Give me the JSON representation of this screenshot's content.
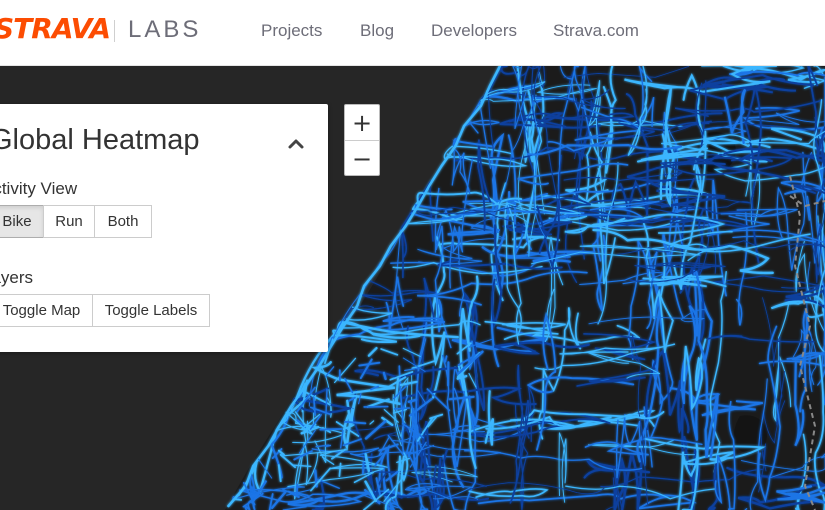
{
  "header": {
    "logo_brand": "STRAVA",
    "logo_sub": "LABS",
    "nav": [
      {
        "label": "Projects"
      },
      {
        "label": "Blog"
      },
      {
        "label": "Developers"
      },
      {
        "label": "Strava.com"
      }
    ]
  },
  "panel": {
    "title": "Global Heatmap",
    "collapse_icon": "chevron-up-icon",
    "activity_view": {
      "label": "Activity View",
      "options": [
        {
          "label": "Bike",
          "active": true
        },
        {
          "label": "Run",
          "active": false
        },
        {
          "label": "Both",
          "active": false
        }
      ]
    },
    "layers": {
      "label": "Layers",
      "options": [
        {
          "label": "Toggle Map"
        },
        {
          "label": "Toggle Labels"
        }
      ]
    }
  },
  "zoom": {
    "in_label": "+",
    "out_label": "−"
  },
  "colors": {
    "brand": "#fc4c02",
    "map_background": "#262626",
    "land": "#1c1c1c",
    "route_bright": "#3ab6ff",
    "route_mid": "#1a74e6",
    "route_dim": "#0d3f9e"
  }
}
